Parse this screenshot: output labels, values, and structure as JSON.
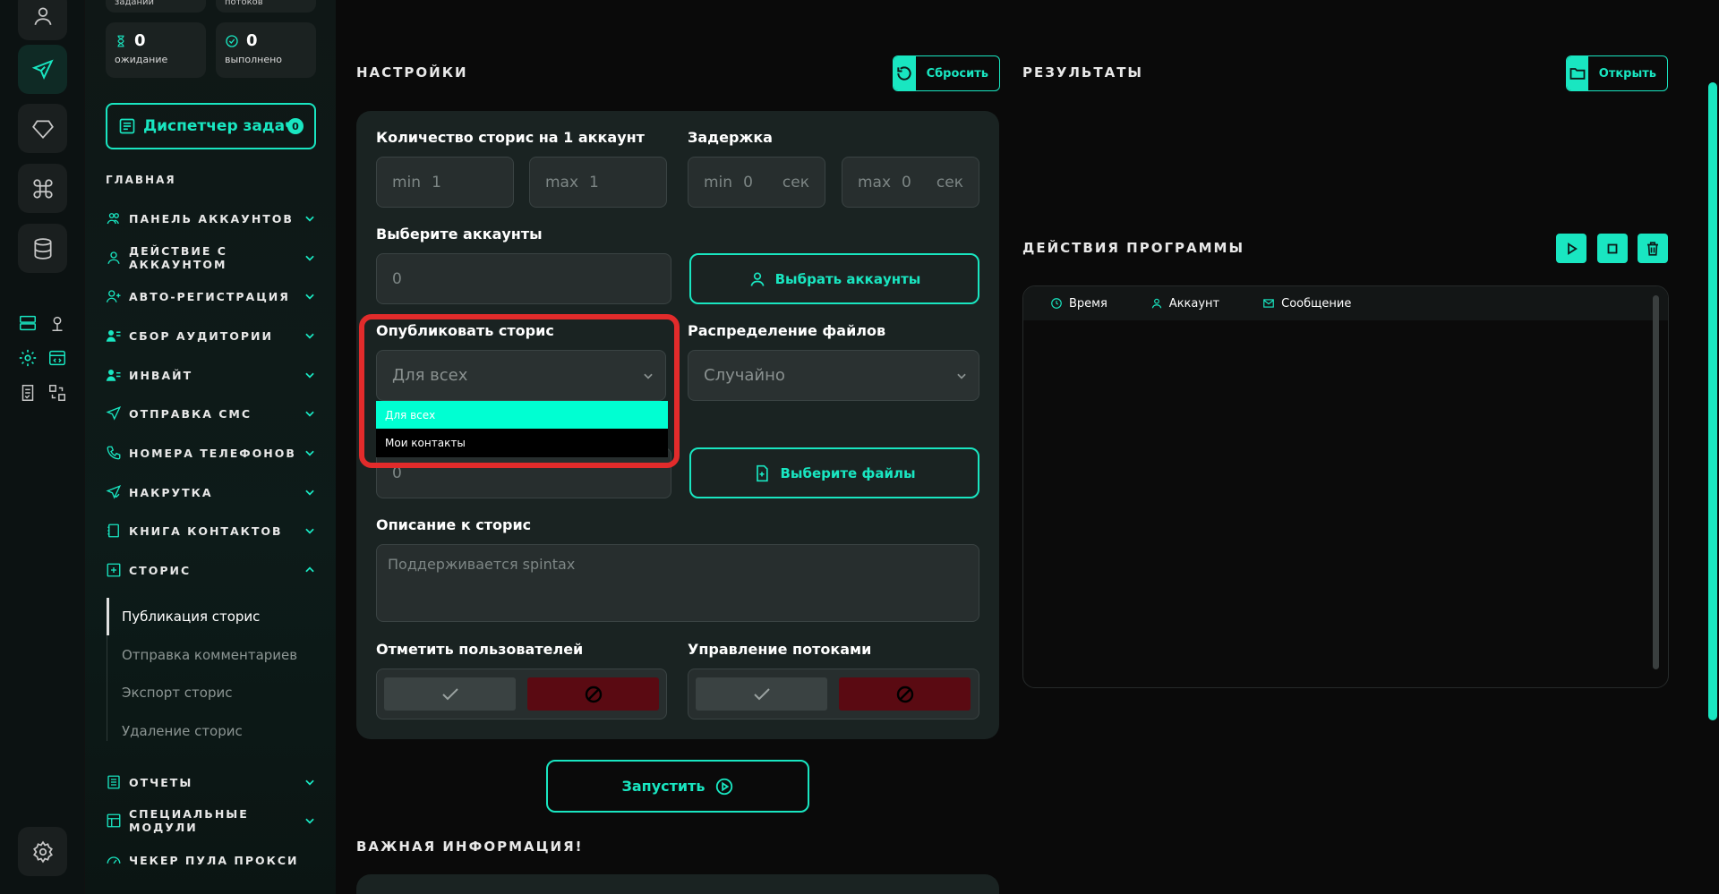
{
  "stats": {
    "tasks_label": "заданий",
    "threads_label": "потоков",
    "waiting_value": "0",
    "waiting_label": "ожидание",
    "done_value": "0",
    "done_label": "выполнено"
  },
  "dispatcher": {
    "label": "Диспетчер задач",
    "badge": "0"
  },
  "nav": {
    "section": "ГЛАВНАЯ",
    "items": [
      "ПАНЕЛЬ АККАУНТОВ",
      "ДЕЙСТВИЕ С АККАУНТОМ",
      "АВТО-РЕГИСТРАЦИЯ",
      "СБОР АУДИТОРИИ",
      "ИНВАЙТ",
      "ОТПРАВКА СМС",
      "НОМЕРА ТЕЛЕФОНОВ",
      "НАКРУТКА",
      "КНИГА КОНТАКТОВ",
      "СТОРИС",
      "ОТЧЕТЫ",
      "СПЕЦИАЛЬНЫЕ МОДУЛИ",
      "ЧЕКЕР ПУЛА ПРОКСИ"
    ],
    "stories_sub": [
      "Публикация сторис",
      "Отправка комментариев",
      "Экспорт сторис",
      "Удаление сторис"
    ]
  },
  "settings": {
    "title": "НАСТРОЙКИ",
    "reset_label": "Сбросить",
    "count_label": "Количество сторис на 1 аккаунт",
    "count_min_prefix": "min",
    "count_min_value": "1",
    "count_max_prefix": "max",
    "count_max_value": "1",
    "delay_label": "Задержка",
    "delay_min_prefix": "min",
    "delay_min_value": "0",
    "delay_min_unit": "сек",
    "delay_max_prefix": "max",
    "delay_max_value": "0",
    "delay_max_unit": "сек",
    "accounts_label": "Выберите аккаунты",
    "accounts_value": "0",
    "select_accounts_button": "Выбрать аккаунты",
    "publish_label": "Опубликовать сторис",
    "publish_value": "Для всех",
    "publish_options": [
      "Для всех",
      "Мои контакты"
    ],
    "distribution_label": "Распределение файлов",
    "distribution_value": "Случайно",
    "files_value": "0",
    "select_files_button": "Выберите файлы",
    "description_label": "Описание к сторис",
    "description_placeholder": "Поддерживается spintax",
    "mark_users_label": "Отметить пользователей",
    "threads_label": "Управление потоками",
    "run_button": "Запустить",
    "important_title": "ВАЖНАЯ ИНФОРМАЦИЯ!"
  },
  "results": {
    "title": "РЕЗУЛЬТАТЫ",
    "open_label": "Открыть"
  },
  "log": {
    "title": "ДЕЙСТВИЯ ПРОГРАММЫ",
    "columns": [
      "Время",
      "Аккаунт",
      "Сообщение"
    ]
  },
  "colors": {
    "accent": "#19e6c1",
    "danger": "#e22b2b",
    "panel": "#1a2322"
  }
}
